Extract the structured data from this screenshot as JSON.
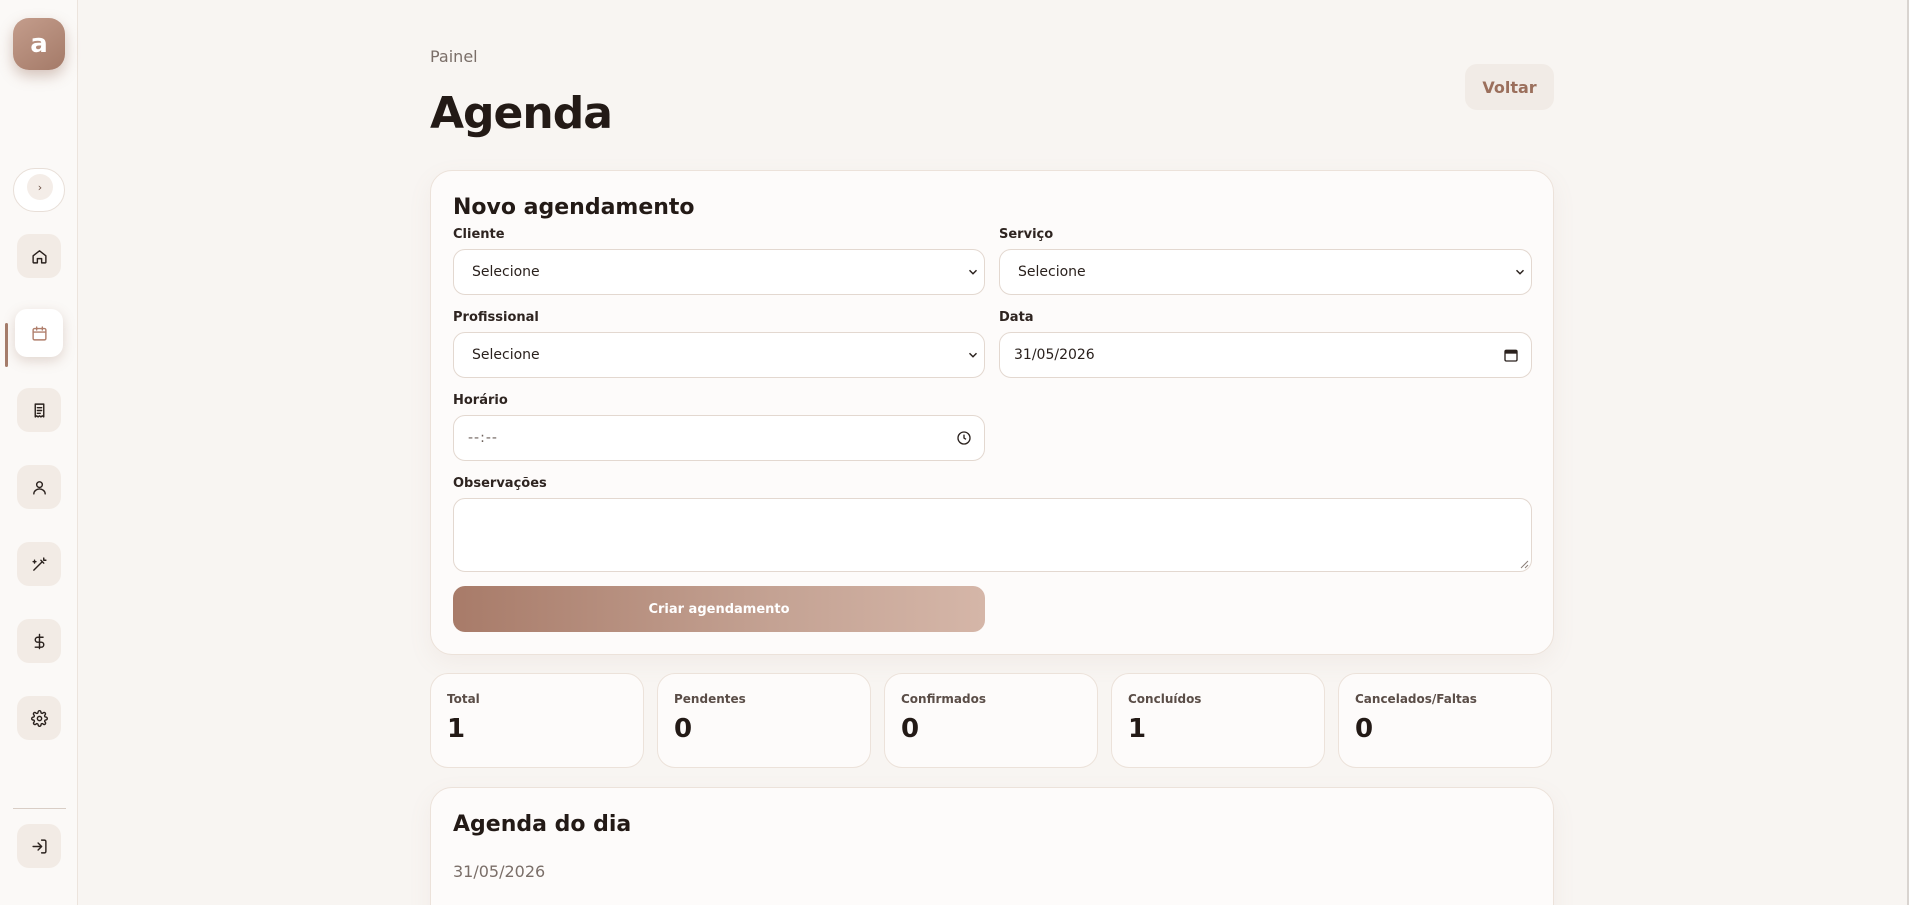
{
  "sidebar": {
    "logo_letter": "a",
    "theme_toggle_glyph": "›",
    "items": [
      {
        "name": "home-icon"
      },
      {
        "name": "calendar-icon",
        "active": true
      },
      {
        "name": "receipt-icon"
      },
      {
        "name": "user-icon"
      },
      {
        "name": "magic-wand-icon"
      },
      {
        "name": "dollar-icon"
      },
      {
        "name": "gear-icon"
      }
    ],
    "logout_icon": "logout-icon"
  },
  "header": {
    "breadcrumb": "Painel",
    "title": "Agenda",
    "back_label": "Voltar"
  },
  "form": {
    "title": "Novo agendamento",
    "client_label": "Cliente",
    "client_value": "Selecione",
    "service_label": "Serviço",
    "service_value": "Selecione",
    "professional_label": "Profissional",
    "professional_value": "Selecione",
    "date_label": "Data",
    "date_value": "31/05/2026",
    "time_label": "Horário",
    "time_value": "--:--",
    "notes_label": "Observações",
    "submit_label": "Criar agendamento"
  },
  "stats": [
    {
      "label": "Total",
      "value": "1"
    },
    {
      "label": "Pendentes",
      "value": "0"
    },
    {
      "label": "Confirmados",
      "value": "0"
    },
    {
      "label": "Concluídos",
      "value": "1"
    },
    {
      "label": "Cancelados/Faltas",
      "value": "0"
    }
  ],
  "day": {
    "title": "Agenda do dia",
    "date": "31/05/2026"
  },
  "colors": {
    "accent": "#a57d6b",
    "background": "#f8f5f2",
    "card": "#fdfbfa"
  }
}
